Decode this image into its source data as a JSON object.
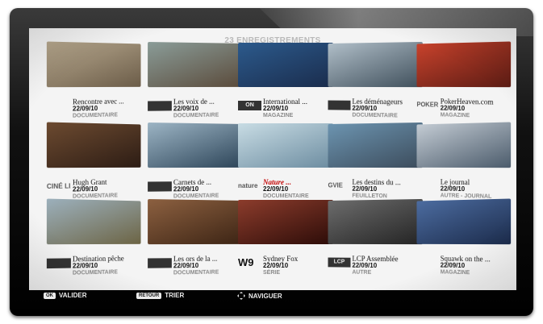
{
  "header": {
    "title": "23 ENREGISTREMENTS"
  },
  "recordings": [
    {
      "name": "Rencontre avec ...",
      "date": "22/09/10",
      "genre": "DOCUMENTAIRE",
      "logo": "",
      "logo_style": "plain",
      "thumb_colors": [
        "#b7a88e",
        "#6b5c48"
      ],
      "highlight": false
    },
    {
      "name": "Les voix de ...",
      "date": "22/09/10",
      "genre": "DOCUMENTAIRE",
      "logo": "",
      "logo_style": "box",
      "thumb_colors": [
        "#8a9c98",
        "#5a4a3a"
      ],
      "highlight": false
    },
    {
      "name": "International ...",
      "date": "22/09/10",
      "genre": "MAGAZINE",
      "logo": "ON",
      "logo_style": "box",
      "thumb_colors": [
        "#2c5a8c",
        "#1a2c4c"
      ],
      "highlight": false
    },
    {
      "name": "Les déménageurs",
      "date": "22/09/10",
      "genre": "DOCUMENTAIRE",
      "logo": "",
      "logo_style": "box",
      "thumb_colors": [
        "#b0bec8",
        "#40505c"
      ],
      "highlight": false
    },
    {
      "name": "PokerHeaven.com",
      "date": "22/09/10",
      "genre": "MAGAZINE",
      "logo": "POKER",
      "logo_style": "plain",
      "thumb_colors": [
        "#c8422c",
        "#5c1c14"
      ],
      "highlight": false
    },
    {
      "name": "Hugh Grant",
      "date": "22/09/10",
      "genre": "DOCUMENTAIRE",
      "logo": "CINÉ LIÃ",
      "logo_style": "plain",
      "thumb_colors": [
        "#6c4a30",
        "#2c1c14"
      ],
      "highlight": false
    },
    {
      "name": "Carnets de ...",
      "date": "22/09/10",
      "genre": "DOCUMENTAIRE",
      "logo": "",
      "logo_style": "box",
      "thumb_colors": [
        "#9cb4c4",
        "#2c4458"
      ],
      "highlight": false
    },
    {
      "name": "Nature ...",
      "date": "22/09/10",
      "genre": "DOCUMENTAIRE",
      "logo": "nature",
      "logo_style": "plain",
      "thumb_colors": [
        "#c8dce4",
        "#6c8ca0"
      ],
      "highlight": true
    },
    {
      "name": "Les destins du ...",
      "date": "22/09/10",
      "genre": "FEUILLETON",
      "logo": "GVIE",
      "logo_style": "plain",
      "thumb_colors": [
        "#6c94b0",
        "#3c4c5c"
      ],
      "highlight": false
    },
    {
      "name": "Le journal",
      "date": "22/09/10",
      "genre": "AUTRE - JOURNAL",
      "logo": "",
      "logo_style": "plain",
      "thumb_colors": [
        "#c4ccd4",
        "#4c5c6c"
      ],
      "highlight": false
    },
    {
      "name": "Destination pêche",
      "date": "22/09/10",
      "genre": "DOCUMENTAIRE",
      "logo": "",
      "logo_style": "box",
      "thumb_colors": [
        "#9cb0bc",
        "#6c6444"
      ],
      "highlight": false
    },
    {
      "name": "Les ors de la ...",
      "date": "22/09/10",
      "genre": "DOCUMENTAIRE",
      "logo": "",
      "logo_style": "box",
      "thumb_colors": [
        "#8c6040",
        "#3c2414"
      ],
      "highlight": false
    },
    {
      "name": "Sydney Fox",
      "date": "22/09/10",
      "genre": "SÉRIE",
      "logo": "W9",
      "logo_style": "big",
      "thumb_colors": [
        "#8c3c2c",
        "#2c0c08"
      ],
      "highlight": false
    },
    {
      "name": "LCP Assemblée",
      "date": "22/09/10",
      "genre": "AUTRE",
      "logo": "LCP",
      "logo_style": "box",
      "thumb_colors": [
        "#6c6c6c",
        "#242424"
      ],
      "highlight": false
    },
    {
      "name": "Squawk on the ...",
      "date": "22/09/10",
      "genre": "MAGAZINE",
      "logo": "",
      "logo_style": "plain",
      "thumb_colors": [
        "#4c6ca0",
        "#1c2c4c"
      ],
      "highlight": false
    }
  ],
  "footer": {
    "valider_key": "OK",
    "valider_label": "VALIDER",
    "trier_key": "RETOUR",
    "trier_label": "TRIER",
    "naviguer_label": "NAVIGUER"
  },
  "colors": {
    "highlight": "#c20000",
    "genre": "#8a8a8a",
    "screen_bg": "#f4f4f4"
  },
  "icons": {
    "navigate": "dpad-icon"
  }
}
